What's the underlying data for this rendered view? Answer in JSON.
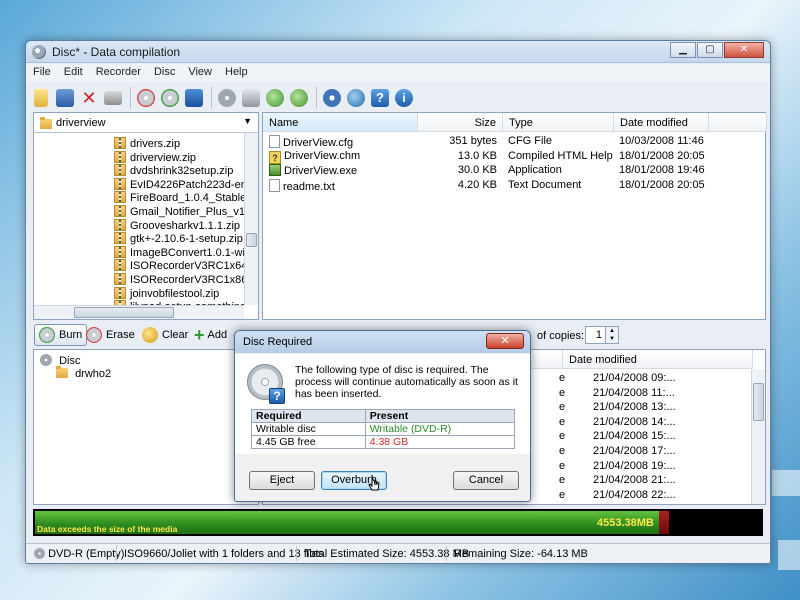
{
  "window": {
    "title": "Disc* - Data compilation"
  },
  "menu": [
    "File",
    "Edit",
    "Recorder",
    "Disc",
    "View",
    "Help"
  ],
  "toolbar_icons": [
    "new-icon",
    "save-icon",
    "delete-icon",
    "print-icon",
    "erase-disc-icon",
    "burn-disc-icon",
    "disc-info-icon",
    "drive-info-icon",
    "media-info-icon",
    "back-icon",
    "forward-icon",
    "settings-icon",
    "refresh-icon",
    "help-icon",
    "info-icon"
  ],
  "folder_tree": {
    "current": "driverview",
    "items": [
      "drivers.zip",
      "driverview.zip",
      "dvdshrink32setup.zip",
      "EvID4226Patch223d-en.z",
      "FireBoard_1.0.4_Stable_C",
      "Gmail_Notifier_Plus_v1.0.z",
      "Groovesharkv1.1.1.zip",
      "gtk+-2.10.6-1-setup.zip",
      "ImageBConvert1.0.1-win3",
      "ISORecorderV3RC1x64.zi",
      "ISORecorderV3RC1x86.zi",
      "joinvobfilestool.zip",
      "lilypad-setup-something.z"
    ]
  },
  "file_list": {
    "columns": [
      "Name",
      "Size",
      "Type",
      "Date modified"
    ],
    "rows": [
      {
        "name": "DriverView.cfg",
        "size": "351 bytes",
        "type": "CFG File",
        "date": "10/03/2008 11:46",
        "icon": "cfg-file-icon"
      },
      {
        "name": "DriverView.chm",
        "size": "13.0 KB",
        "type": "Compiled HTML Help f...",
        "date": "18/01/2008 20:05",
        "icon": "chm-file-icon"
      },
      {
        "name": "DriverView.exe",
        "size": "30.0 KB",
        "type": "Application",
        "date": "18/01/2008 19:46",
        "icon": "exe-file-icon"
      },
      {
        "name": "readme.txt",
        "size": "4.20 KB",
        "type": "Text Document",
        "date": "18/01/2008 20:05",
        "icon": "txt-file-icon"
      }
    ]
  },
  "compilation_toolbar": {
    "burn": "Burn",
    "erase": "Erase",
    "clear": "Clear",
    "add": "Add",
    "copies_label": "of copies:",
    "copies_value": "1"
  },
  "disc_tree": {
    "root": "Disc",
    "child": "drwho2"
  },
  "disc_list": {
    "date_header": "Date modified",
    "rows": [
      {
        "type": "e",
        "date": "21/04/2008 09:..."
      },
      {
        "type": "e",
        "date": "21/04/2008 11:..."
      },
      {
        "type": "e",
        "date": "21/04/2008 13:..."
      },
      {
        "type": "e",
        "date": "21/04/2008 14:..."
      },
      {
        "type": "e",
        "date": "21/04/2008 15:..."
      },
      {
        "type": "e",
        "date": "21/04/2008 17:..."
      },
      {
        "type": "e",
        "date": "21/04/2008 19:..."
      },
      {
        "type": "e",
        "date": "21/04/2008 21:..."
      },
      {
        "type": "e",
        "date": "21/04/2008 22:..."
      }
    ]
  },
  "progress": {
    "message": "Data exceeds the size of the media",
    "value_label": "4553.38MB",
    "fill_fraction": 0.86,
    "overflow_fraction": 0.014,
    "colors": {
      "fill": "#3da82a",
      "overflow": "#8b1414"
    }
  },
  "status": {
    "disc": "DVD-R (Empty)",
    "format": "ISO9660/Joliet with 1 folders and 13 files",
    "total": "Total Estimated Size: 4553.38 MB",
    "remaining": "Remaining Size: -64.13 MB"
  },
  "dialog": {
    "title": "Disc Required",
    "message": "The following type of disc is required. The process will continue automatically as soon as it has been inserted.",
    "table": {
      "headers": [
        "Required",
        "Present"
      ],
      "rows": [
        {
          "required": "Writable disc",
          "present": "Writable (DVD-R)",
          "present_color": "#2a8a2a"
        },
        {
          "required": "4.45 GB free",
          "present": "4.38 GB",
          "present_color": "#d42a2a"
        }
      ]
    },
    "buttons": {
      "eject": "Eject",
      "overburn": "Overburn",
      "cancel": "Cancel"
    }
  }
}
